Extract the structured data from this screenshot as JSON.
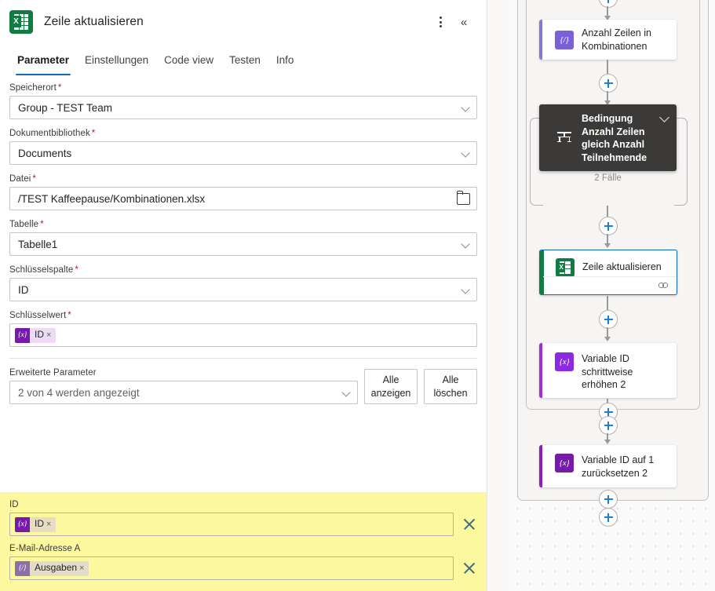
{
  "panel": {
    "app_icon": "excel-icon",
    "title": "Zeile aktualisieren",
    "more_icon": "more-vertical-icon",
    "collapse_icon": "double-chevron-left-icon",
    "tabs": [
      {
        "label": "Parameter",
        "active": true
      },
      {
        "label": "Einstellungen",
        "active": false
      },
      {
        "label": "Code view",
        "active": false
      },
      {
        "label": "Testen",
        "active": false
      },
      {
        "label": "Info",
        "active": false
      }
    ],
    "fields": [
      {
        "label": "Speicherort",
        "required": "*",
        "value": "Group - TEST Team",
        "type": "dropdown"
      },
      {
        "label": "Dokumentbibliothek",
        "required": "*",
        "value": "Documents",
        "type": "dropdown"
      },
      {
        "label": "Datei",
        "required": "*",
        "value": "/TEST Kaffeepause/Kombinationen.xlsx",
        "type": "file"
      },
      {
        "label": "Tabelle",
        "required": "*",
        "value": "Tabelle1",
        "type": "dropdown"
      },
      {
        "label": "Schlüsselspalte",
        "required": "*",
        "value": "ID",
        "type": "dropdown"
      }
    ],
    "key_value": {
      "label": "Schlüsselwert",
      "required": "*",
      "token": {
        "badge": "{x}",
        "name": "ID",
        "remove": "×"
      }
    },
    "advanced": {
      "label": "Erweiterte Parameter",
      "value": "2 von 4 werden angezeigt",
      "show_all_button": "Alle anzeigen",
      "clear_all_button": "Alle löschen"
    },
    "highlighted": [
      {
        "label": "ID",
        "token": {
          "badge": "{x}",
          "name": "ID",
          "remove": "×"
        },
        "delete_icon": "close-icon"
      },
      {
        "label": "E-Mail-Adresse A",
        "token": {
          "badge": "{/}",
          "name": "Ausgaben",
          "remove": "×"
        },
        "delete_icon": "close-icon"
      }
    ]
  },
  "canvas": {
    "nodes": [
      {
        "id": "n1",
        "title": "Anzahl Zeilen in Kombinationen",
        "icon": "{/}",
        "icon_bg": "#7b61d9",
        "accent": "#8378de",
        "kind": "compose"
      },
      {
        "id": "n2",
        "title": "Bedingung Anzahl Zeilen gleich Anzahl Teilnehmende",
        "icon": "switch-icon",
        "kind": "switch",
        "cases": "2 Fälle",
        "chevron": "chevron-down-icon"
      },
      {
        "id": "n3",
        "title": "Zeile aktualisieren",
        "icon": "excel-icon",
        "icon_bg": "#107c41",
        "accent": "#107c41",
        "kind": "excel",
        "selected": true,
        "footer_icon": "link-icon"
      },
      {
        "id": "n4",
        "title": "Variable ID schrittweise erhöhen 2",
        "icon": "{x}",
        "icon_bg": "#8a2be2",
        "accent": "#9b30d9",
        "kind": "variable"
      },
      {
        "id": "n5",
        "title": "Variable ID auf 1 zurücksetzen 2",
        "icon": "{x}",
        "icon_bg": "#7719aa",
        "accent": "#8a1fbd",
        "kind": "variable"
      }
    ],
    "add_buttons": 6,
    "add_icon": "plus-icon"
  },
  "colors": {
    "accent_blue": "#0f6cbd",
    "excel_green": "#107c41",
    "variable_purple": "#7719aa",
    "highlight_yellow": "#fbf8a0",
    "required_red": "#a4262c"
  }
}
